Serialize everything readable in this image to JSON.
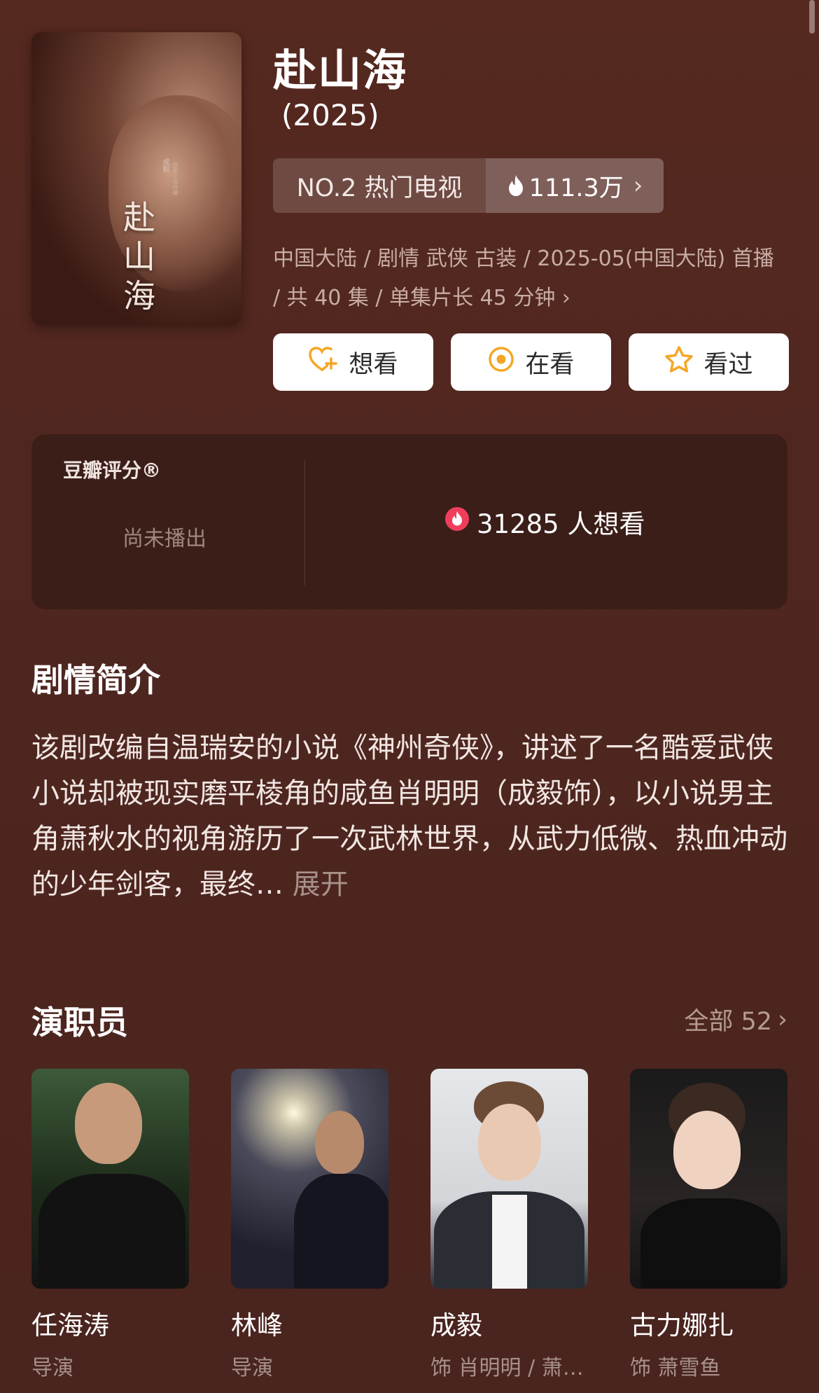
{
  "show": {
    "title": "赴山海",
    "year": "(2025)",
    "poster_title": "赴山海",
    "poster_credit": "成毅",
    "poster_subtitle": "原著小说改编"
  },
  "ranking": {
    "label": "NO.2 热门电视",
    "heat": "111.3万",
    "heat_icon": "flame-icon"
  },
  "meta": {
    "line": "中国大陆 / 剧情 武侠 古装 / 2025-05(中国大陆) 首播 / 共 40 集 / 单集片长 45 分钟"
  },
  "actions": [
    {
      "label": "想看",
      "icon": "heart-plus-icon"
    },
    {
      "label": "在看",
      "icon": "target-icon"
    },
    {
      "label": "看过",
      "icon": "star-icon"
    }
  ],
  "rating": {
    "label": "豆瓣评分®",
    "status": "尚未播出",
    "want_count": "31285 人想看"
  },
  "synopsis": {
    "heading": "剧情简介",
    "text": "该剧改编自温瑞安的小说《神州奇侠》，讲述了一名酷爱武侠小说却被现实磨平棱角的咸鱼肖明明（成毅饰），以小说男主角萧秋水的视角游历了一次武林世界，从武力低微、热血冲动的少年剑客，最终…",
    "expand": "展开"
  },
  "cast": {
    "heading": "演职员",
    "all_label": "全部 52",
    "members": [
      {
        "name": "任海涛",
        "role": "导演"
      },
      {
        "name": "林峰",
        "role": "导演"
      },
      {
        "name": "成毅",
        "role": "饰 肖明明 / 萧…"
      },
      {
        "name": "古力娜扎",
        "role": "饰 萧雪鱼"
      }
    ]
  },
  "colors": {
    "background": "#4e2620",
    "card": "#3b1e18",
    "accent_orange": "#f5a623",
    "flame_red": "#ef3e5c"
  }
}
